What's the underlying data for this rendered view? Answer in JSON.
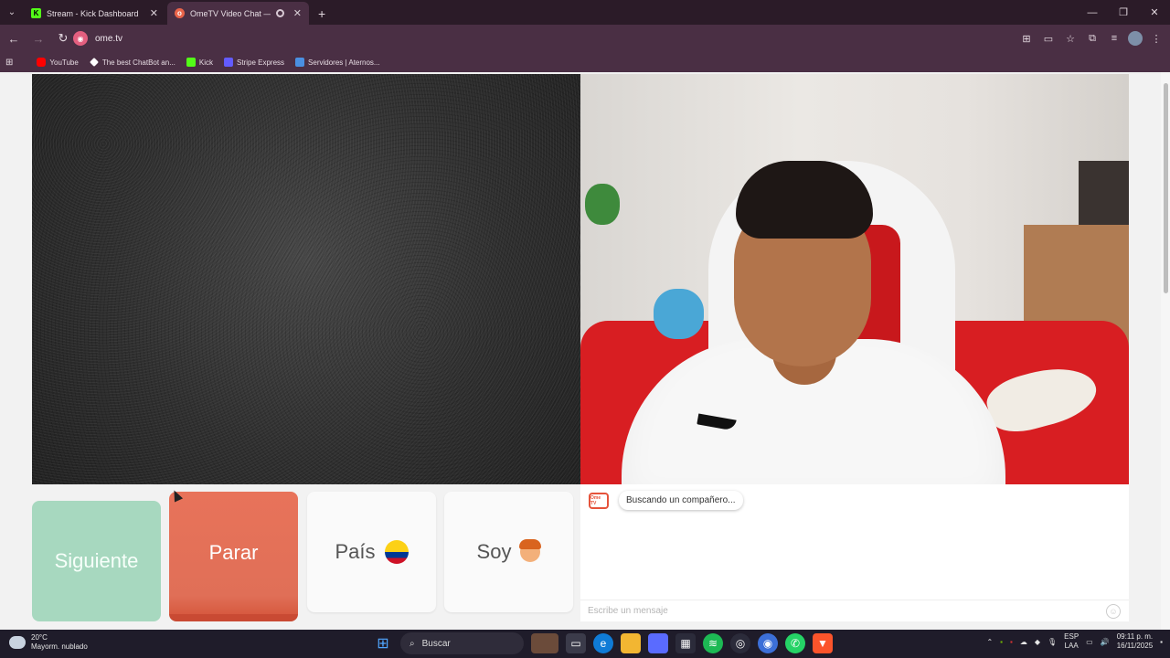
{
  "browser": {
    "tabs": [
      {
        "title": "Stream - Kick Dashboard",
        "active": false,
        "favicon": "kick-icon"
      },
      {
        "title": "OmeTV Video Chat — Ome",
        "active": true,
        "favicon": "ometv-icon"
      }
    ],
    "url": "ome.tv",
    "bookmarks": [
      {
        "label": "YouTube",
        "icon": "youtube-icon",
        "color": "#ff0000"
      },
      {
        "label": "The best ChatBot an...",
        "icon": "chatbot-icon",
        "color": "#ffffff"
      },
      {
        "label": "Kick",
        "icon": "kick-icon",
        "color": "#53fc18"
      },
      {
        "label": "Stripe Express",
        "icon": "stripe-icon",
        "color": "#635bff"
      },
      {
        "label": "Servidores | Aternos...",
        "icon": "aternos-icon",
        "color": "#4a90e2"
      }
    ],
    "colors": {
      "frame": "#2b1b28",
      "toolbar": "#4a2f44"
    }
  },
  "ometv": {
    "buttons": {
      "next": "Siguiente",
      "stop": "Parar",
      "country": "País",
      "gender": "Soy"
    },
    "chat": {
      "logo": "Ome TV",
      "status_message": "Buscando un compañero...",
      "input_placeholder": "Escribe un mensaje"
    },
    "colors": {
      "next": "#a7d8bf",
      "stop": "#e8735a",
      "accent": "#e5533b"
    }
  },
  "taskbar": {
    "weather_temp": "20°C",
    "weather_desc": "Mayorm. nublado",
    "search_label": "Buscar",
    "lang_line1": "ESP",
    "lang_line2": "LAA",
    "time": "09:11 p. m.",
    "date": "16/11/2025"
  }
}
